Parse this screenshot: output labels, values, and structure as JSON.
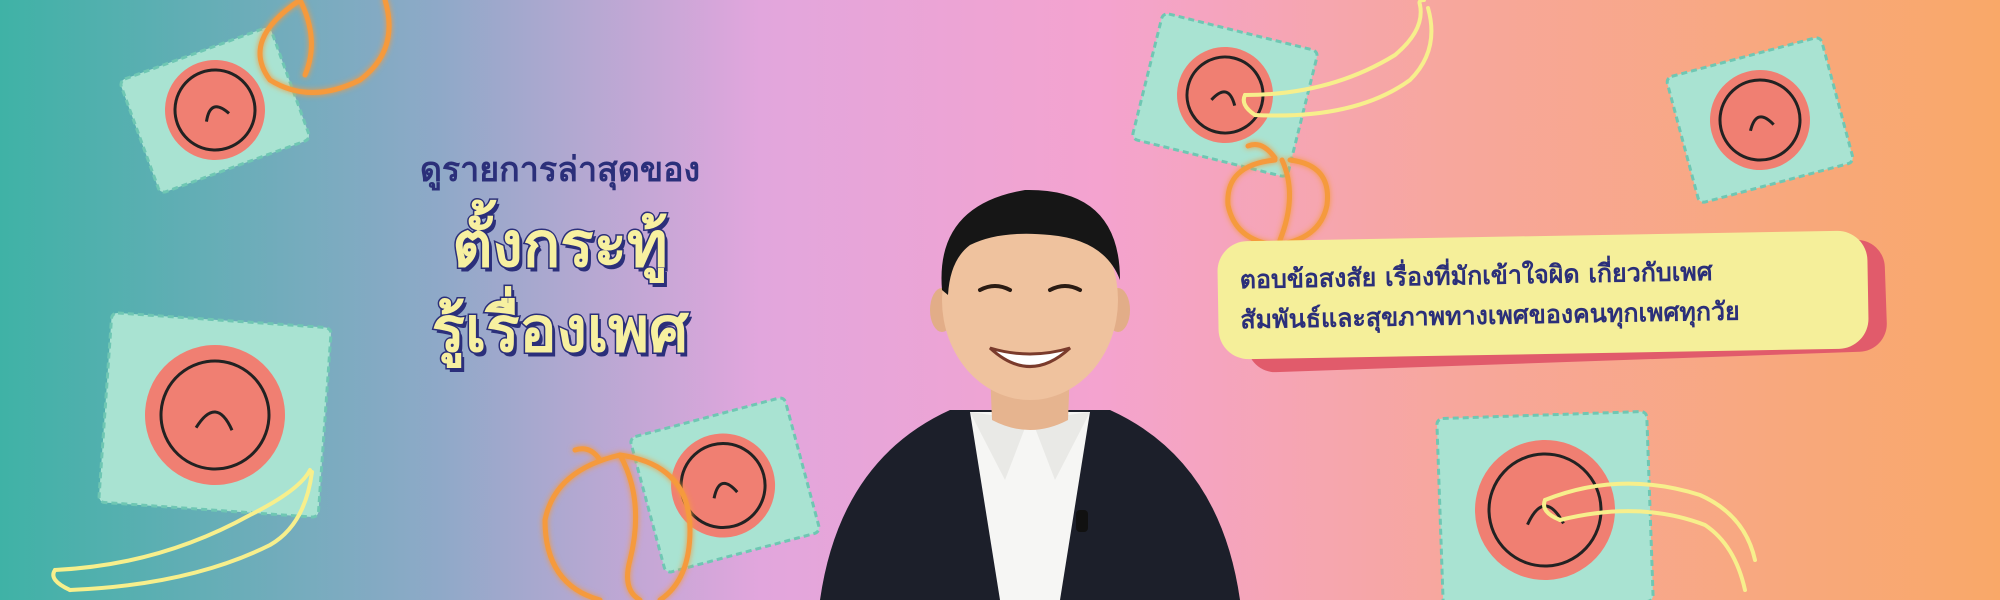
{
  "heading": {
    "kicker": "ดูรายการล่าสุดของ",
    "title_line1": "ตั้งกระทู้",
    "title_line2": "รู้เรื่องเพศ"
  },
  "speech_bubble": {
    "line1": "ตอบข้อสงสัย เรื่องที่มักเข้าใจผิด เกี่ยวกับเพศ",
    "line2": "สัมพันธ์และสุขภาพทางเพศของคนทุกเพศทุกวัย"
  },
  "colors": {
    "navy": "#2b2f7a",
    "title_yellow": "#f7f0a0",
    "bubble_yellow": "#f5ef9a",
    "bubble_shadow": "#e15b6b",
    "packet_mint": "#a9e3d2",
    "packet_coral": "#f07f72",
    "peach_orange": "#f59a3c",
    "banana_yellow": "#f7ef8c"
  },
  "decorations": [
    "condom-packet-icon",
    "peach-outline-icon",
    "banana-outline-icon",
    "host-photo"
  ]
}
